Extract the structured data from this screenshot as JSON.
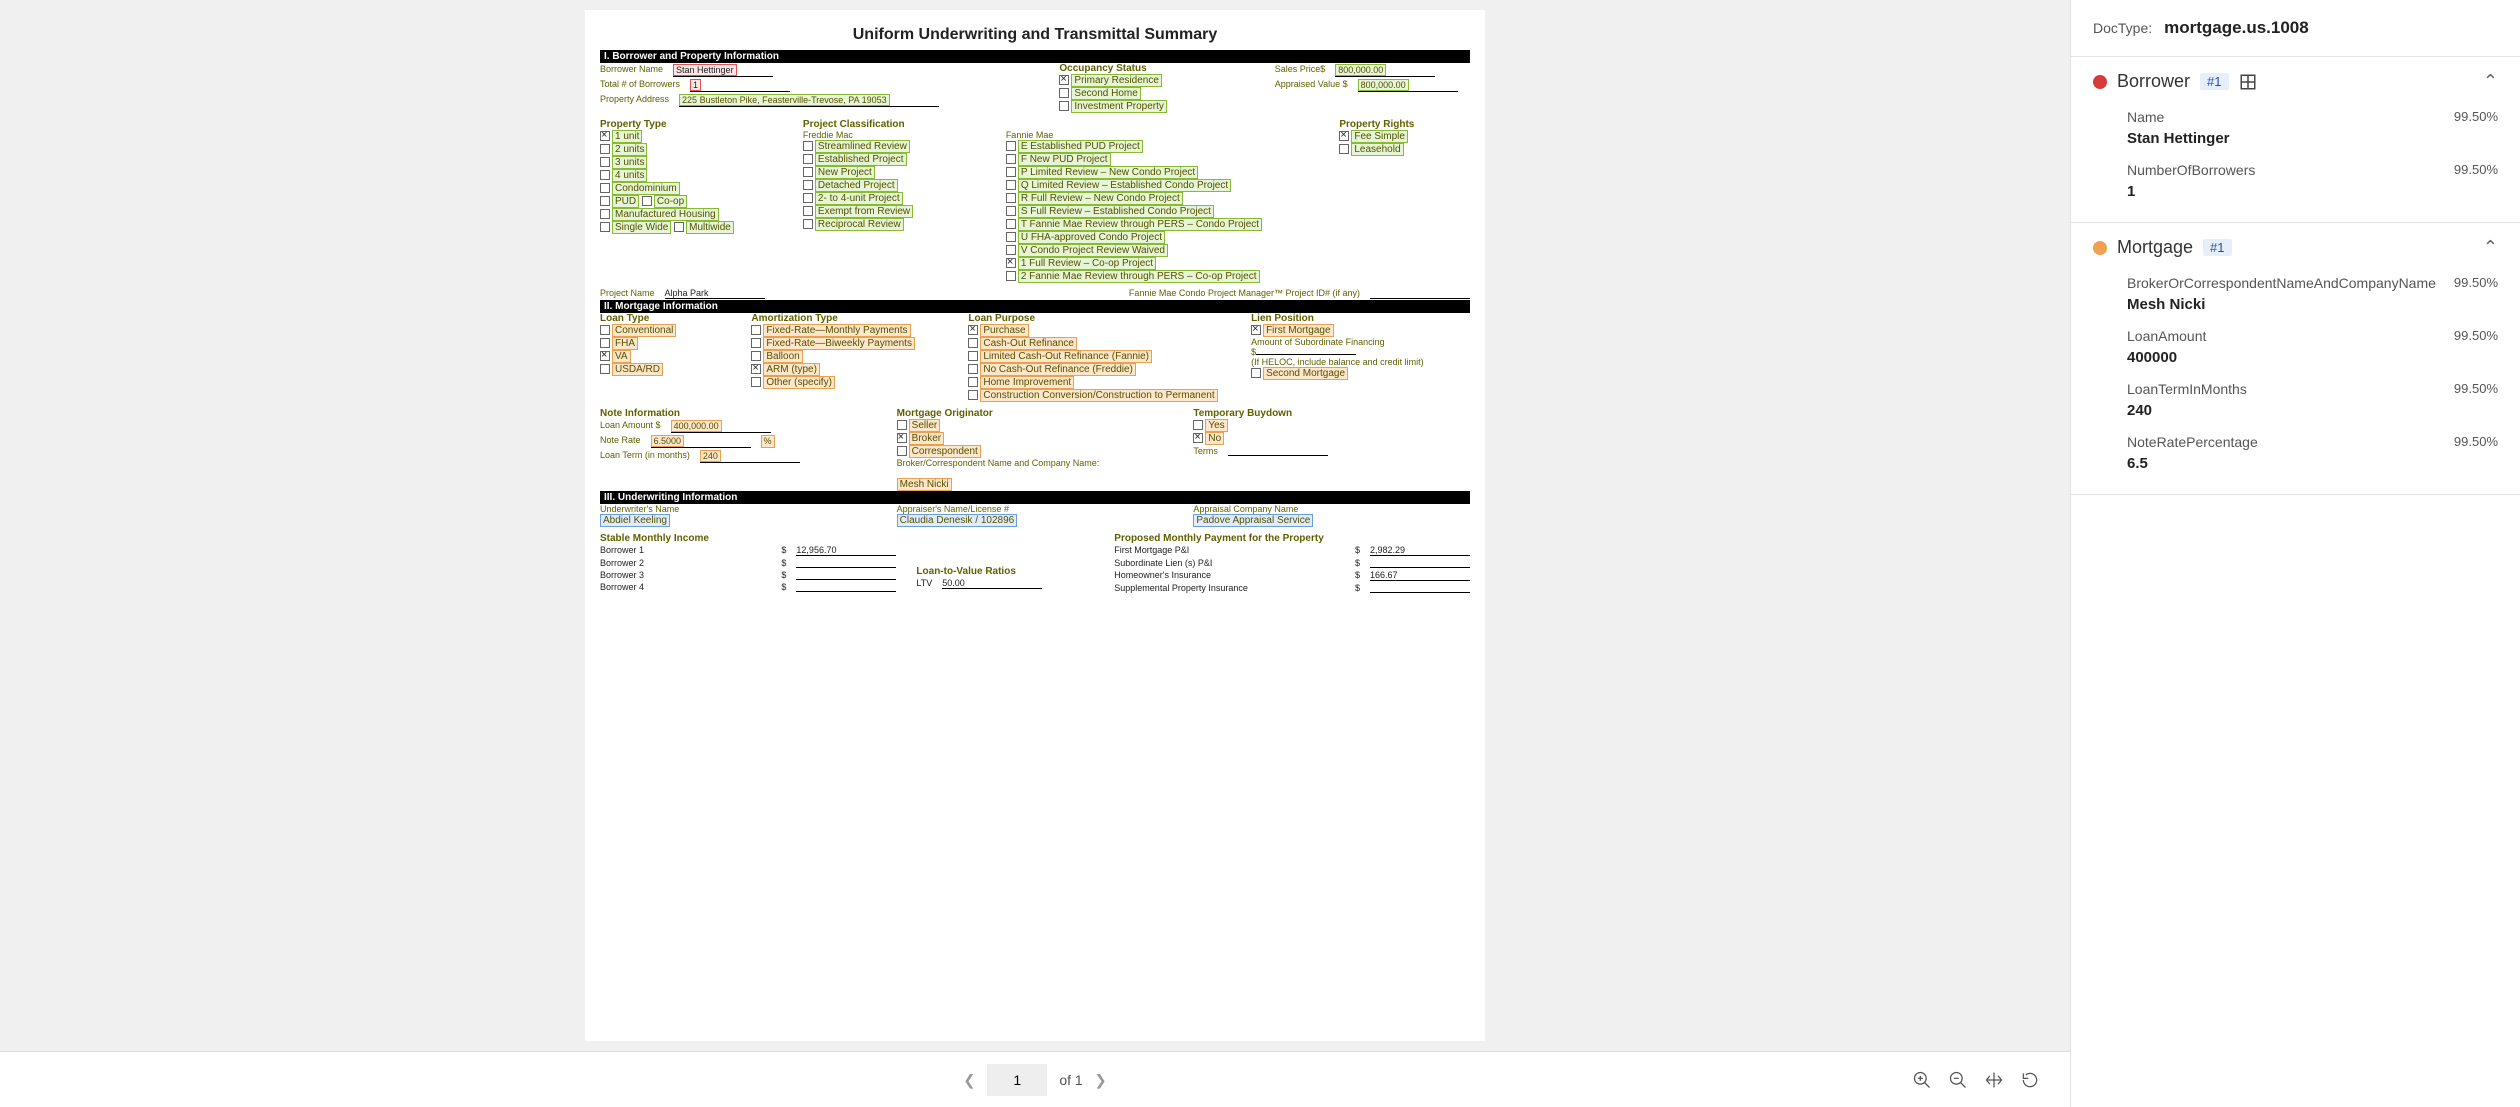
{
  "doc": {
    "title": "Uniform Underwriting and Transmittal Summary",
    "section1": "I. Borrower and Property Information",
    "borrower_name_label": "Borrower Name",
    "borrower_name": "Stan Hettinger",
    "total_borrowers_label": "Total # of Borrowers",
    "total_borrowers": "1",
    "property_address_label": "Property Address",
    "property_address": "225 Bustleton Pike, Feasterville-Trevose, PA 19053",
    "occupancy_label": "Occupancy Status",
    "occ1": "Primary Residence",
    "occ2": "Second Home",
    "occ3": "Investment Property",
    "sales_label": "Sales Price$",
    "sales_value": "800,000.00",
    "appraised_label": "Appraised Value $",
    "appraised_value": "800,000.00",
    "property_type_label": "Property Type",
    "pt1": "1 unit",
    "pt2": "2 units",
    "pt3": "3 units",
    "pt4": "4 units",
    "pt5": "Condominium",
    "pt6a": "PUD",
    "pt6b": "Co-op",
    "pt7": "Manufactured Housing",
    "pt8a": "Single Wide",
    "pt8b": "Multiwide",
    "project_class_label": "Project Classification",
    "freddie_mac": "Freddie Mac",
    "fm1": "Streamlined Review",
    "fm2": "Established Project",
    "fm3": "New Project",
    "fm4": "Detached Project",
    "fm5": "2- to 4-unit Project",
    "fm6": "Exempt from Review",
    "fm7": "Reciprocal Review",
    "fannie_mae": "Fannie Mae",
    "fn1": "E Established PUD Project",
    "fn2": "F New PUD Project",
    "fn3": "P Limited Review – New Condo Project",
    "fn4": "Q Limited Review – Established Condo Project",
    "fn5": "R Full Review – New Condo Project",
    "fn6": "S Full Review – Established Condo Project",
    "fn7": "T Fannie Mae Review through PERS – Condo Project",
    "fn8": "U FHA-approved Condo Project",
    "fn9": "V Condo Project Review Waived",
    "fn10": "1 Full Review – Co-op Project",
    "fn11": "2 Fannie Mae Review through PERS – Co-op Project",
    "property_rights_label": "Property Rights",
    "pr1": "Fee Simple",
    "pr2": "Leasehold",
    "project_name_label": "Project Name",
    "project_name_value": "Alpha Park",
    "fannie_id_label": "Fannie Mae Condo Project Manager™ Project ID# (if any)",
    "section2": "II. Mortgage Information",
    "loan_type_label": "Loan Type",
    "lt1": "Conventional",
    "lt2": "FHA",
    "lt3": "VA",
    "lt4": "USDA/RD",
    "amort_label": "Amortization Type",
    "am1": "Fixed-Rate—Monthly Payments",
    "am2": "Fixed-Rate—Biweekly Payments",
    "am3": "Balloon",
    "am4": "ARM (type)",
    "am5": "Other (specify)",
    "loan_purpose_label": "Loan Purpose",
    "lp1": "Purchase",
    "lp2": "Cash-Out Refinance",
    "lp3": "Limited Cash-Out Refinance (Fannie)",
    "lp4": "No Cash-Out Refinance (Freddie)",
    "lp5": "Home Improvement",
    "lp6": "Construction Conversion/Construction to Permanent",
    "lien_label": "Lien Position",
    "lien1": "First Mortgage",
    "lien_sub": "Amount of Subordinate Financing",
    "lien_dollar": "$",
    "lien_heloc": "(If HELOC, include balance and credit limit)",
    "lien2": "Second Mortgage",
    "note_info_label": "Note Information",
    "loan_amount_label": "Loan Amount $",
    "loan_amount": "400,000.00",
    "note_rate_label": "Note Rate",
    "note_rate": "6.5000",
    "note_rate_pct": "%",
    "loan_term_label": "Loan Term (in months)",
    "loan_term": "240",
    "mort_orig_label": "Mortgage Originator",
    "mo1": "Seller",
    "mo2": "Broker",
    "mo3": "Correspondent",
    "broker_corr_label": "Broker/Correspondent Name and Company Name:",
    "broker_name": "Mesh Nicki",
    "temp_buydown_label": "Temporary Buydown",
    "tb1": "Yes",
    "tb2": "No",
    "terms_label": "Terms",
    "section3": "III. Underwriting Information",
    "uw_name_label": "Underwriter's Name",
    "uw_name": "Abdiel Keeling",
    "appraiser_label": "Appraiser's Name/License #",
    "appraiser": "Claudia Denesik / 102896",
    "appraisal_co_label": "Appraisal Company Name",
    "appraisal_co": "Padove Appraisal Service",
    "stable_income_label": "Stable Monthly Income",
    "b1": "Borrower 1",
    "b2": "Borrower 2",
    "b3": "Borrower 3",
    "b4": "Borrower 4",
    "b1_amt": "12,956.70",
    "proposed_label": "Proposed Monthly Payment for the Property",
    "p1": "First Mortgage P&I",
    "p2": "Subordinate Lien (s) P&I",
    "p3": "Homeowner's Insurance",
    "p4": "Supplemental Property Insurance",
    "p1_amt": "2,982.29",
    "p3_amt": "166.67",
    "ltv_label": "Loan-to-Value Ratios",
    "ltv_row": "LTV",
    "ltv_val": "50.00"
  },
  "toolbar": {
    "page": "1",
    "of_total": "of 1"
  },
  "panel": {
    "doctype_label": "DocType:",
    "doctype_value": "mortgage.us.1008",
    "borrower": {
      "title": "Borrower",
      "badge": "#1",
      "fields": [
        {
          "label": "Name",
          "conf": "99.50%",
          "value": "Stan Hettinger"
        },
        {
          "label": "NumberOfBorrowers",
          "conf": "99.50%",
          "value": "1"
        }
      ]
    },
    "mortgage": {
      "title": "Mortgage",
      "badge": "#1",
      "fields": [
        {
          "label": "BrokerOrCorrespondentNameAndCompanyName",
          "conf": "99.50%",
          "value": "Mesh Nicki"
        },
        {
          "label": "LoanAmount",
          "conf": "99.50%",
          "value": "400000"
        },
        {
          "label": "LoanTermInMonths",
          "conf": "99.50%",
          "value": "240"
        },
        {
          "label": "NoteRatePercentage",
          "conf": "99.50%",
          "value": "6.5"
        }
      ]
    }
  }
}
